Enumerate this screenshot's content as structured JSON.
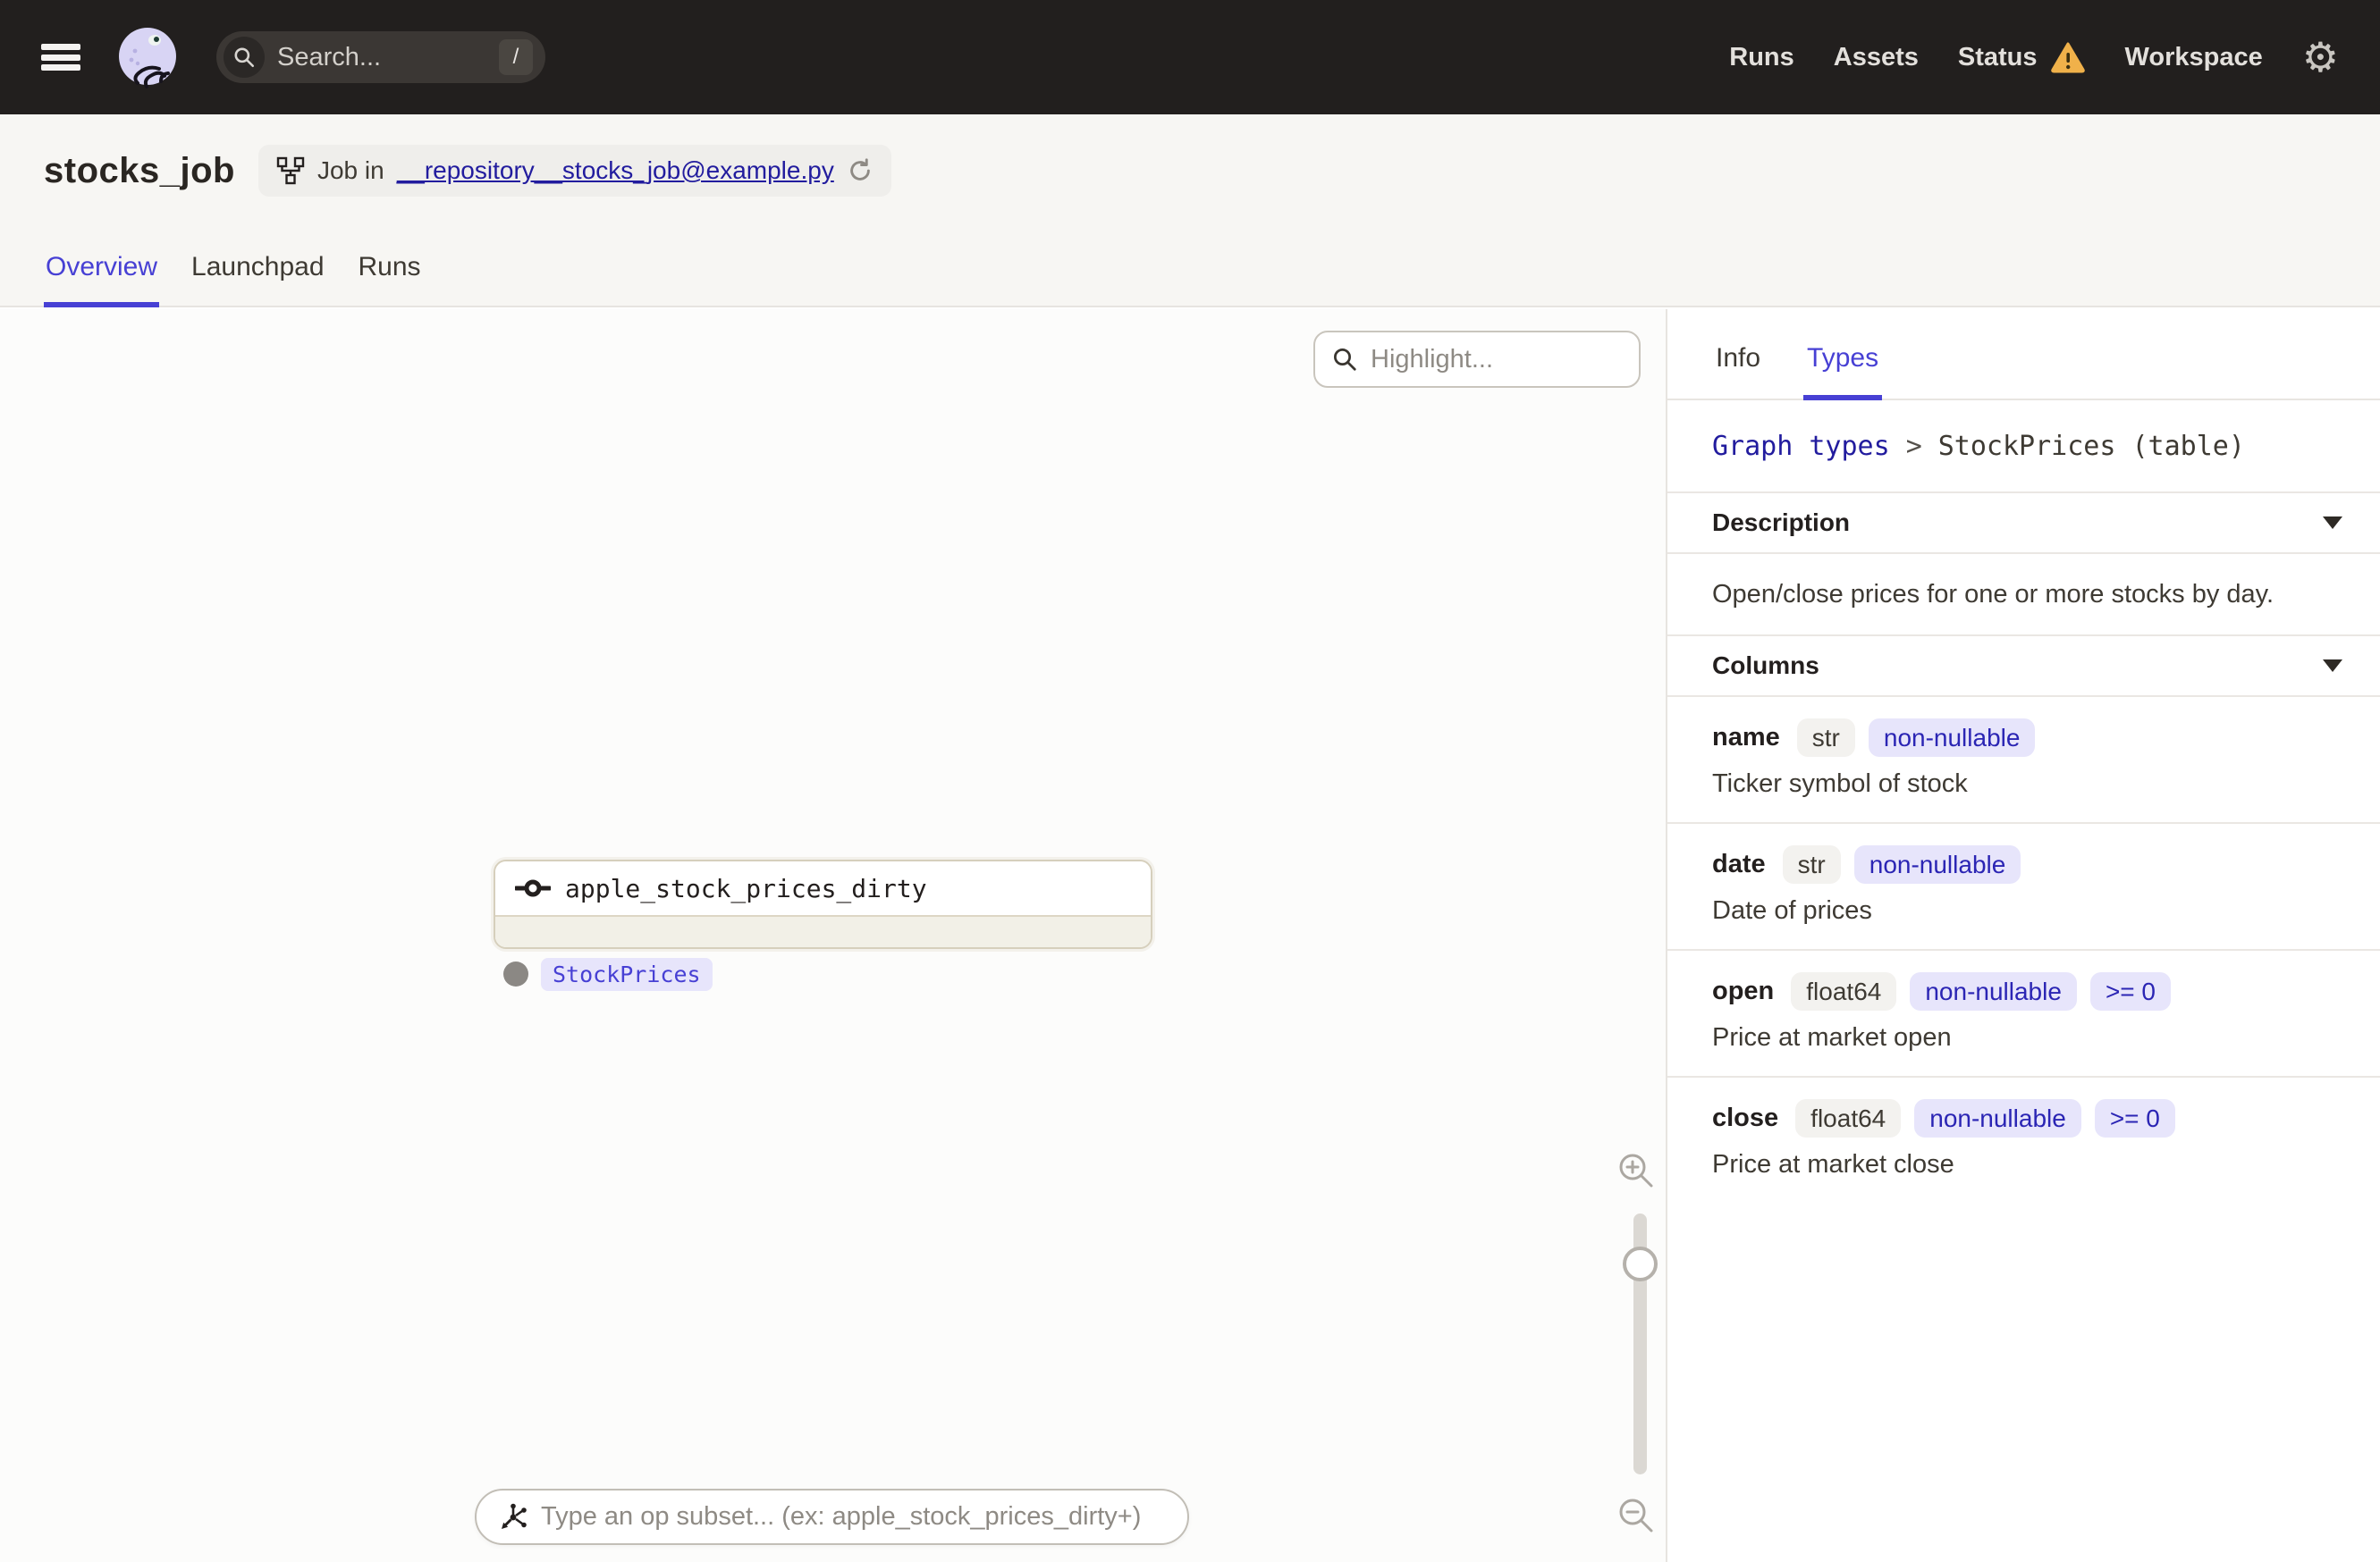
{
  "nav": {
    "search": {
      "placeholder": "Search...",
      "shortcut": "/"
    },
    "links": {
      "runs": "Runs",
      "assets": "Assets",
      "status": "Status",
      "workspace": "Workspace"
    },
    "gear_glyph": "⚙"
  },
  "header": {
    "title": "stocks_job",
    "job_badge": {
      "prefix": "Job in",
      "link": "__repository__stocks_job@example.py"
    },
    "tabs": [
      {
        "label": "Overview",
        "active": true
      },
      {
        "label": "Launchpad",
        "active": false
      },
      {
        "label": "Runs",
        "active": false
      }
    ]
  },
  "canvas": {
    "highlight_placeholder": "Highlight...",
    "node": {
      "title": "apple_stock_prices_dirty",
      "tag": "StockPrices"
    },
    "op_subset_placeholder": "Type an op subset... (ex: apple_stock_prices_dirty+)"
  },
  "panel": {
    "tabs": [
      {
        "label": "Info",
        "active": false
      },
      {
        "label": "Types",
        "active": true
      }
    ],
    "breadcrumb": {
      "link": "Graph types",
      "separator": ">",
      "current": "StockPrices (table)"
    },
    "description": {
      "label": "Description",
      "text": "Open/close prices for one or more stocks by day."
    },
    "columns": {
      "label": "Columns",
      "items": [
        {
          "name": "name",
          "type": "str",
          "nullability": "non-nullable",
          "description": "Ticker symbol of stock"
        },
        {
          "name": "date",
          "type": "str",
          "nullability": "non-nullable",
          "description": "Date of prices"
        },
        {
          "name": "open",
          "type": "float64",
          "nullability": "non-nullable",
          "constraint": ">= 0",
          "description": "Price at market open"
        },
        {
          "name": "close",
          "type": "float64",
          "nullability": "non-nullable",
          "constraint": ">= 0",
          "description": "Price at market close"
        }
      ]
    }
  },
  "colors": {
    "accent": "#4740D4",
    "link_navy": "#221C9E",
    "warning": "#F0B14A",
    "nav_bg": "#221F1E",
    "tag_bg": "#E7E5FB",
    "node_border": "#D6CFBC"
  }
}
